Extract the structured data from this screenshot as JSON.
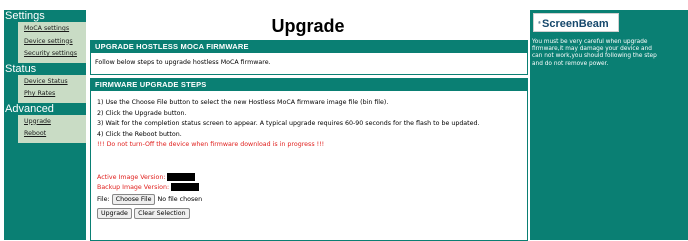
{
  "sidebar": {
    "sections": [
      {
        "title": "Settings",
        "links": [
          "MoCA settings",
          "Device settings",
          "Security settings"
        ]
      },
      {
        "title": "Status",
        "links": [
          "Device Status",
          "Phy Rates"
        ]
      },
      {
        "title": "Advanced",
        "links": [
          "Upgrade",
          "Reboot"
        ]
      }
    ]
  },
  "main": {
    "title": "Upgrade",
    "panel1": {
      "heading": "UPGRADE HOSTLESS MOCA FIRMWARE",
      "text": "Follow below steps to upgrade hostless MoCA firmware."
    },
    "panel2": {
      "heading": "FIRMWARE UPGRADE STEPS",
      "steps": [
        "1) Use the Choose File button to select the new Hostless MoCA firmware image file (bin file).",
        "2) Click the Upgrade button.",
        "3) Wait for the completion status screen to appear. A typical upgrade requires 60-90 seconds for the flash to be updated.",
        "4) Click the Reboot button."
      ],
      "warning": "!!! Do not turn-Off the device when firmware download is in progress !!!",
      "active_label": "Active Image Version:",
      "backup_label": "Backup Image Version:",
      "file_label": "File:",
      "choose_file": "Choose File",
      "no_file": "No file chosen",
      "upgrade_btn": "Upgrade",
      "clear_btn": "Clear Selection"
    }
  },
  "right": {
    "logo": "ScreenBeam",
    "logo_mark": "®",
    "note": "You must be very careful when upgrade firmware,it may damage your device and can not work,you should following the step and do not remove power."
  },
  "colors": {
    "teal": "#0a7f73",
    "warning": "#e0201e",
    "link_box": "#c9dcc5",
    "logo_text": "#16486c"
  }
}
